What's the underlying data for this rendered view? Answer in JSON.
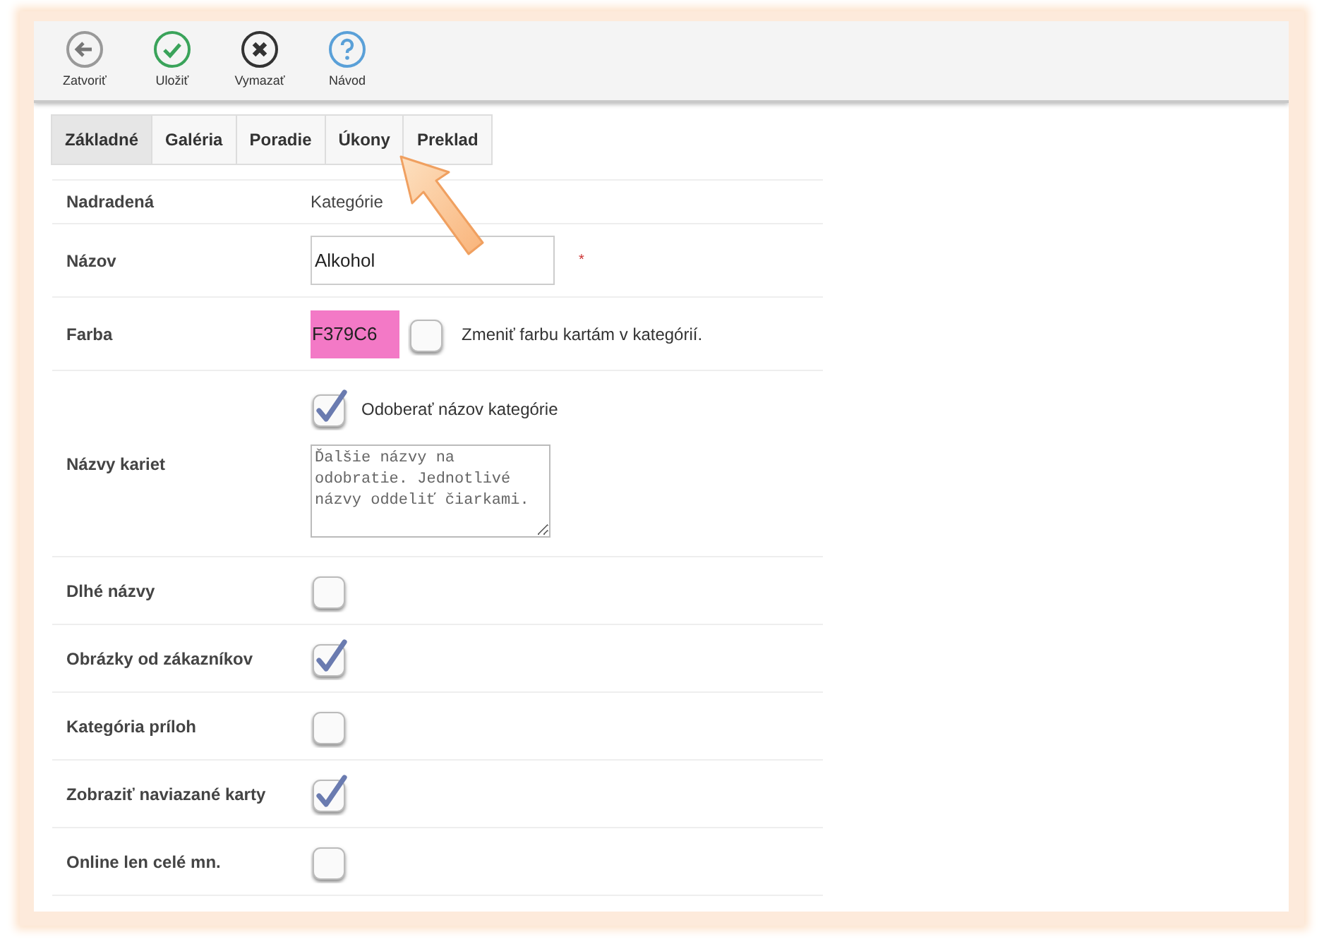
{
  "toolbar": [
    {
      "kind": "back",
      "label": "Zatvoriť"
    },
    {
      "kind": "save",
      "label": "Uložiť"
    },
    {
      "kind": "delete",
      "label": "Vymazať"
    },
    {
      "kind": "help",
      "label": "Návod"
    }
  ],
  "tabs": [
    {
      "label": "Základné",
      "selected": true
    },
    {
      "label": "Galéria",
      "selected": false
    },
    {
      "label": "Poradie",
      "selected": false
    },
    {
      "label": "Úkony",
      "selected": false
    },
    {
      "label": "Preklad",
      "selected": false
    }
  ],
  "rows": [
    {
      "kind": "text",
      "label": "Nadradená",
      "value": "Kategórie"
    },
    {
      "kind": "input",
      "label": "Názov",
      "value": "Alkohol",
      "required_mark": "*"
    },
    {
      "kind": "color",
      "label": "Farba",
      "value": "F379C6",
      "color": "#f379c6",
      "checkbox": {
        "checked": false,
        "label": "Zmeniť farbu kartám v kategórií."
      }
    },
    {
      "kind": "names",
      "label": "Názvy kariet",
      "checkbox": {
        "checked": true,
        "label": "Odoberať názov kategórie"
      },
      "textarea": {
        "placeholder": "Ďalšie názvy na odobratie. Jednotlivé názvy oddeliť čiarkami."
      }
    },
    {
      "kind": "checkbox",
      "label": "Dlhé názvy",
      "checked": false
    },
    {
      "kind": "checkbox",
      "label": "Obrázky od zákazníkov",
      "checked": true
    },
    {
      "kind": "checkbox",
      "label": "Kategória príloh",
      "checked": false
    },
    {
      "kind": "checkbox",
      "label": "Zobraziť naviazané karty",
      "checked": true
    },
    {
      "kind": "checkbox",
      "label": "Online len celé mn.",
      "checked": false
    }
  ]
}
